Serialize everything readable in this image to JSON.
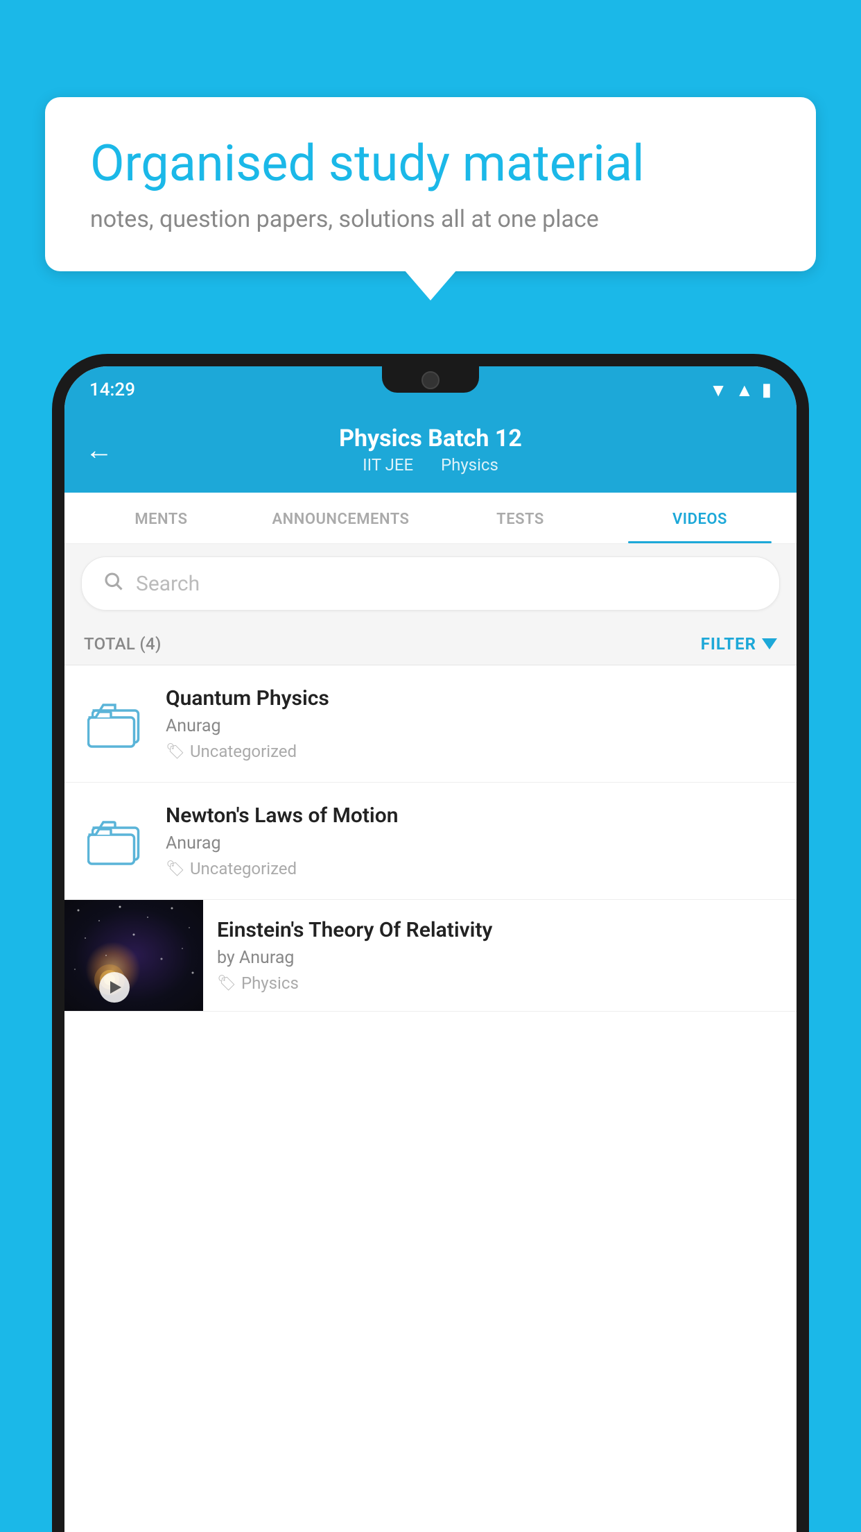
{
  "background": {
    "color": "#1BB8E8"
  },
  "speech_bubble": {
    "headline": "Organised study material",
    "subtext": "notes, question papers, solutions all at one place"
  },
  "phone": {
    "status_bar": {
      "time": "14:29",
      "wifi_icon": "wifi",
      "signal_icon": "signal",
      "battery_icon": "battery"
    },
    "header": {
      "back_label": "←",
      "title": "Physics Batch 12",
      "tag1": "IIT JEE",
      "tag2": "Physics"
    },
    "tabs": [
      {
        "label": "MENTS",
        "active": false
      },
      {
        "label": "ANNOUNCEMENTS",
        "active": false
      },
      {
        "label": "TESTS",
        "active": false
      },
      {
        "label": "VIDEOS",
        "active": true
      }
    ],
    "search": {
      "placeholder": "Search"
    },
    "filter_bar": {
      "total_label": "TOTAL (4)",
      "filter_label": "FILTER"
    },
    "videos": [
      {
        "id": 1,
        "title": "Quantum Physics",
        "author": "Anurag",
        "tag": "Uncategorized",
        "type": "folder"
      },
      {
        "id": 2,
        "title": "Newton's Laws of Motion",
        "author": "Anurag",
        "tag": "Uncategorized",
        "type": "folder"
      },
      {
        "id": 3,
        "title": "Einstein's Theory Of Relativity",
        "author": "by Anurag",
        "tag": "Physics",
        "type": "thumbnail"
      }
    ]
  }
}
